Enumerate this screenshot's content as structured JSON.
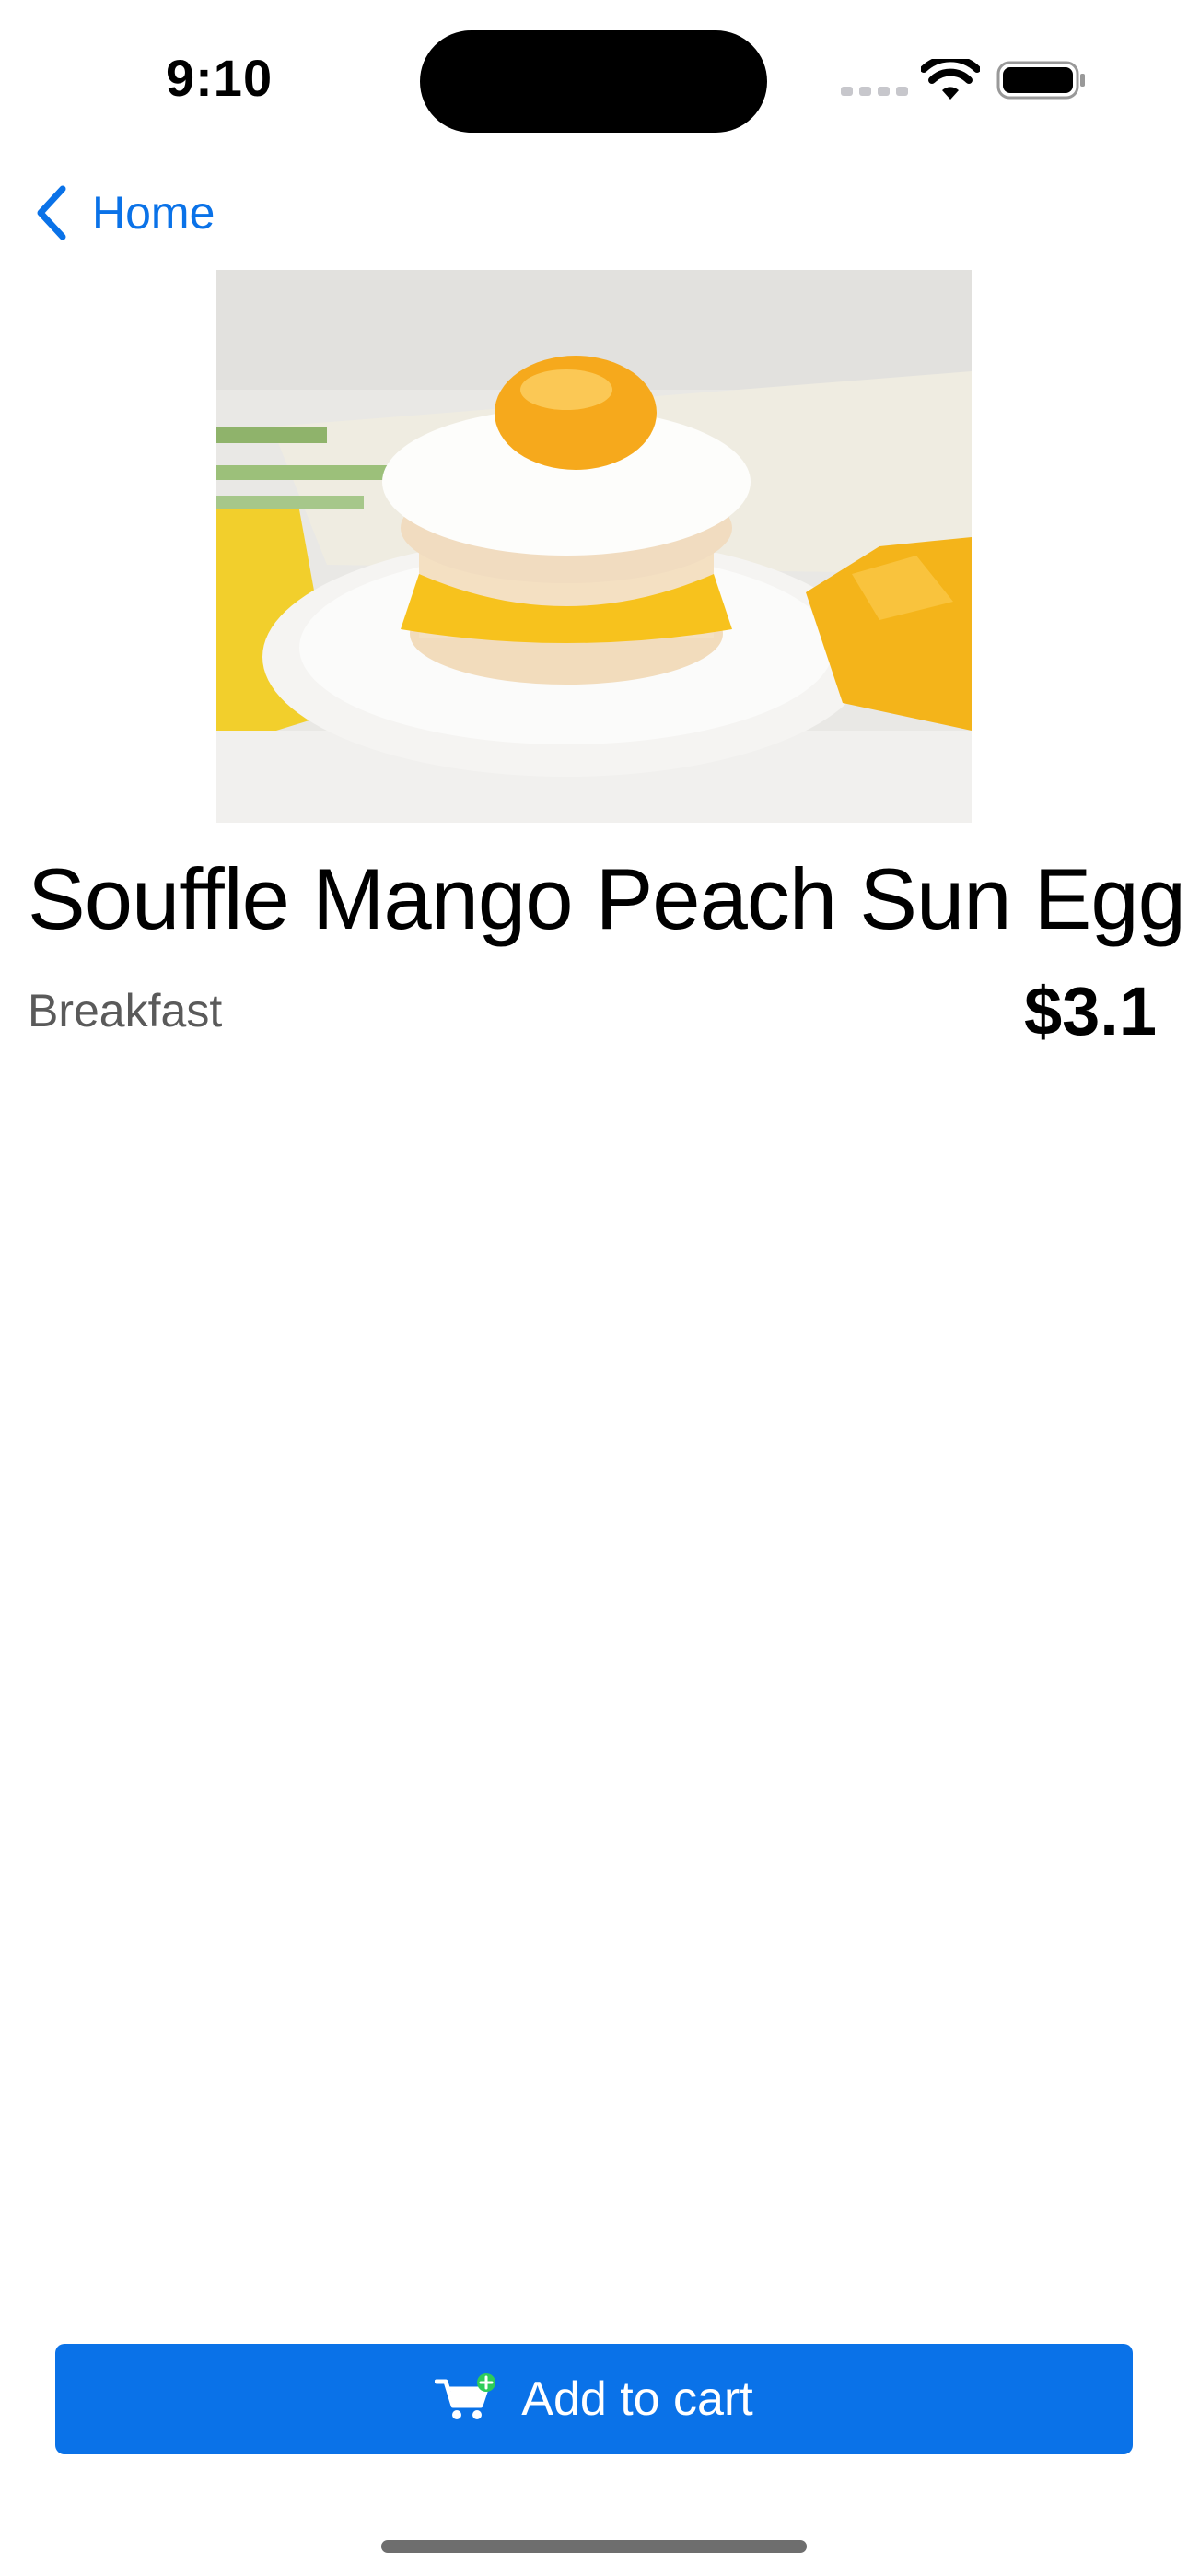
{
  "status_bar": {
    "time": "9:10"
  },
  "nav": {
    "back_label": "Home"
  },
  "product": {
    "name": "Souffle Mango Peach Sun Egg",
    "category": "Breakfast",
    "price": "$3.1",
    "image_icon": "product-photo"
  },
  "actions": {
    "add_to_cart_label": "Add to cart",
    "cart_icon": "cart-add-icon"
  },
  "colors": {
    "accent": "#0a72e8",
    "badge_green": "#2ecc5a",
    "secondary_text": "#5a5a5a"
  }
}
